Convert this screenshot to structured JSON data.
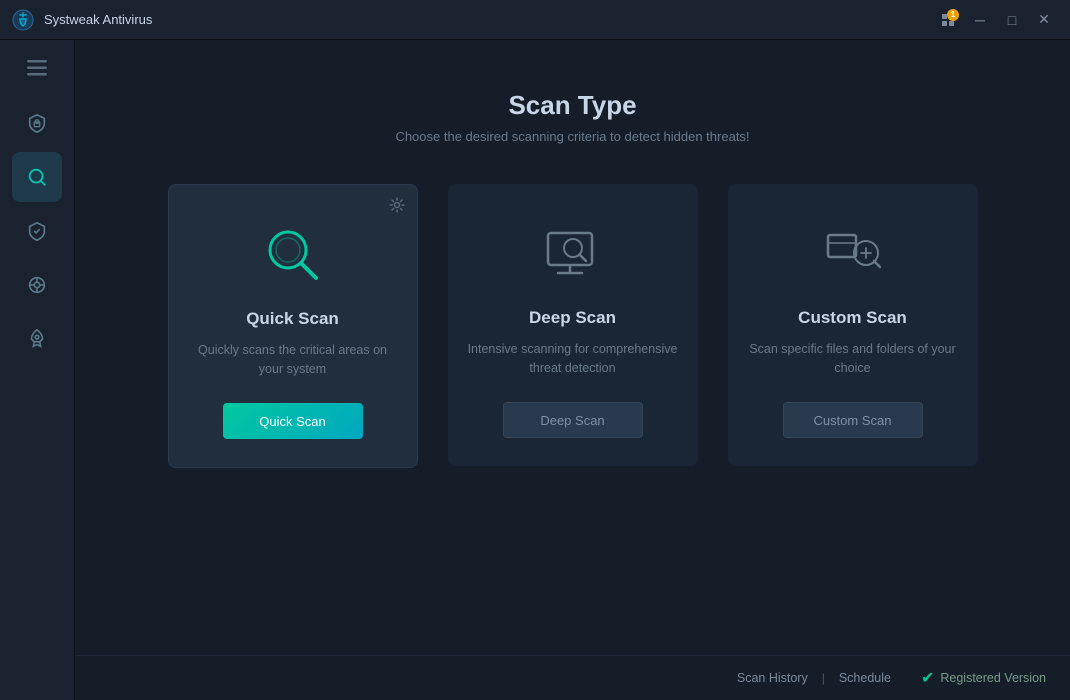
{
  "titlebar": {
    "app_name": "Systweak Antivirus",
    "notification_count": "1",
    "btn_minimize": "─",
    "btn_maximize": "□",
    "btn_close": "✕"
  },
  "sidebar": {
    "menu_label": "Menu",
    "items": [
      {
        "id": "protection",
        "label": "Protection"
      },
      {
        "id": "scan",
        "label": "Scan",
        "active": true
      },
      {
        "id": "shield",
        "label": "Shield"
      },
      {
        "id": "firewall",
        "label": "Firewall"
      },
      {
        "id": "boost",
        "label": "Boost"
      }
    ]
  },
  "page": {
    "title": "Scan Type",
    "subtitle": "Choose the desired scanning criteria to detect hidden threats!"
  },
  "scan_cards": [
    {
      "id": "quick-scan",
      "title": "Quick Scan",
      "description": "Quickly scans the critical areas on your system",
      "button_label": "Quick Scan",
      "button_type": "primary",
      "active": true,
      "has_settings": true
    },
    {
      "id": "deep-scan",
      "title": "Deep Scan",
      "description": "Intensive scanning for comprehensive threat detection",
      "button_label": "Deep Scan",
      "button_type": "secondary",
      "active": false,
      "has_settings": false
    },
    {
      "id": "custom-scan",
      "title": "Custom Scan",
      "description": "Scan specific files and folders of your choice",
      "button_label": "Custom Scan",
      "button_type": "secondary",
      "active": false,
      "has_settings": false
    }
  ],
  "footer": {
    "scan_history_label": "Scan History",
    "schedule_label": "Schedule",
    "registered_label": "Registered Version"
  }
}
